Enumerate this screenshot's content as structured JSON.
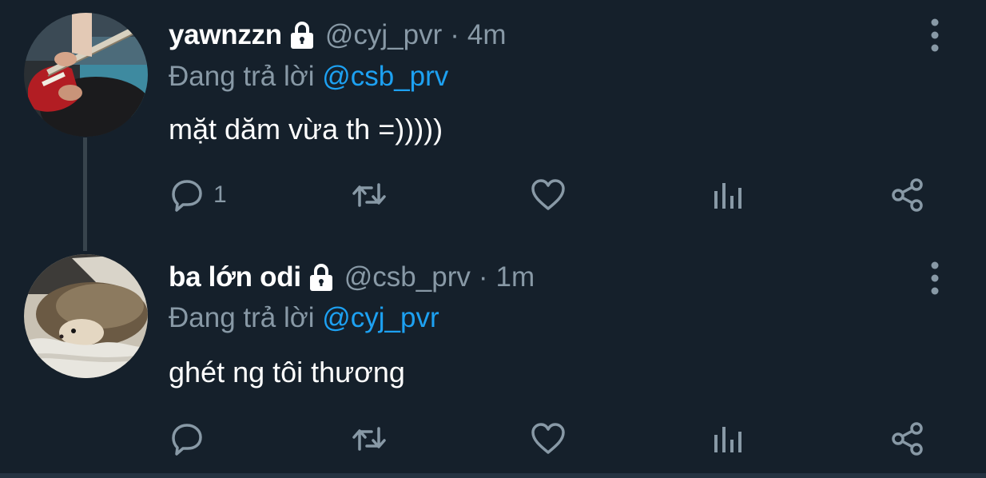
{
  "tweets": [
    {
      "display_name": "yawnzzn",
      "handle": "@cyj_pvr",
      "separator": "·",
      "time": "4m",
      "replying_prefix": "Đang trả lời",
      "replying_to": "@csb_prv",
      "text": "mặt dăm vừa th =)))))",
      "reply_count": "1",
      "avatar": "bass-guitar-photo"
    },
    {
      "display_name": "ba lớn odi",
      "handle": "@csb_prv",
      "separator": "·",
      "time": "1m",
      "replying_prefix": "Đang trả lời",
      "replying_to": "@cyj_pvr",
      "text": "ghét ng tôi thương",
      "reply_count": "",
      "avatar": "hedgehog-photo"
    }
  ],
  "icons": [
    "lock-icon",
    "more-vertical-icon",
    "reply-icon",
    "retweet-icon",
    "like-icon",
    "analytics-icon",
    "share-icon"
  ],
  "colors": {
    "background": "#15202b",
    "secondary_text": "#8899a6",
    "link": "#1da1f2",
    "thread_line": "#38444d"
  }
}
